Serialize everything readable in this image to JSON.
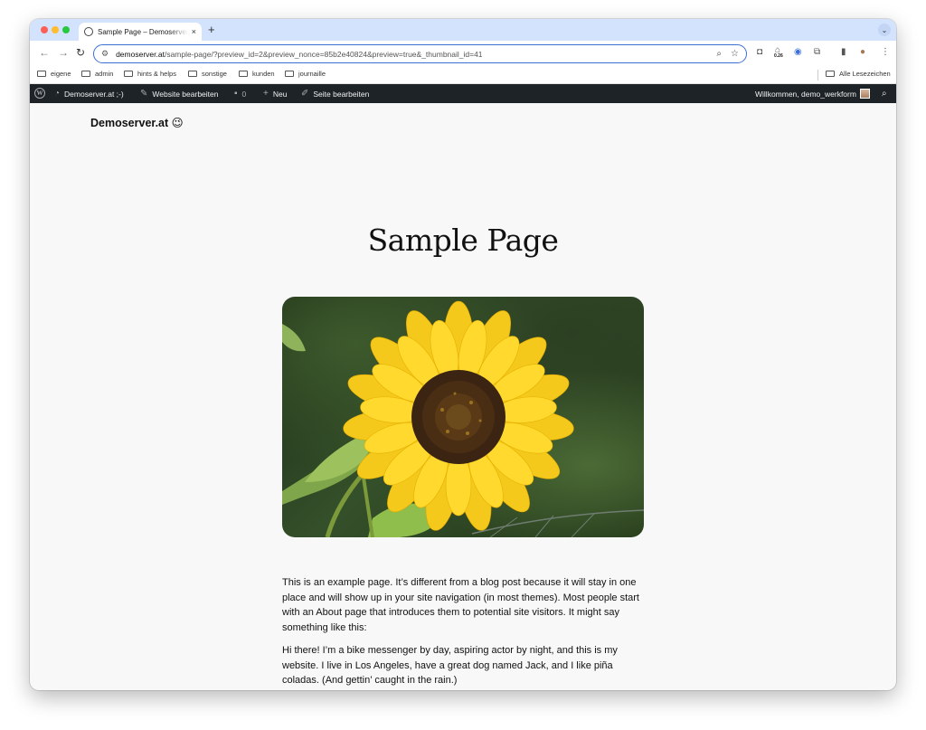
{
  "browser": {
    "tab_title": "Sample Page – Demoserver.at ;-)",
    "tab_close": "×",
    "new_tab": "+",
    "tab_menu": "⌄",
    "url_host": "demoserver.at",
    "url_path": "/sample-page/?preview_id=2&preview_nonce=85b2e40824&preview=true&_thumbnail_id=41",
    "extension_badge": "0.26",
    "bookmarks": [
      "eigene",
      "admin",
      "hints & helps",
      "sonstige",
      "kunden",
      "journaille"
    ],
    "all_bookmarks": "Alle Lesezeichen"
  },
  "adminbar": {
    "site_name": "Demoserver.at ;-)",
    "edit_site": "Website bearbeiten",
    "comments_count": "0",
    "new_label": "Neu",
    "edit_page": "Seite bearbeiten",
    "greeting": "Willkommen, demo_werkform"
  },
  "page": {
    "site_title": "Demoserver.at 😉",
    "title": "Sample Page",
    "paragraphs": [
      "This is an example page. It’s different from a blog post because it will stay in one place and will show up in your site navigation (in most themes). Most people start with an About page that introduces them to potential site visitors. It might say something like this:",
      "Hi there! I’m a bike messenger by day, aspiring actor by night, and this is my website. I live in Los Angeles, have a great dog named Jack, and I like piña coladas. (And gettin’ caught in the rain.)"
    ]
  },
  "colors": {
    "adminbar_bg": "#1d2327",
    "tabstrip_bg": "#d3e3fd",
    "page_bg": "#f8f8f8",
    "omnibox_border": "#3b6fd6"
  }
}
